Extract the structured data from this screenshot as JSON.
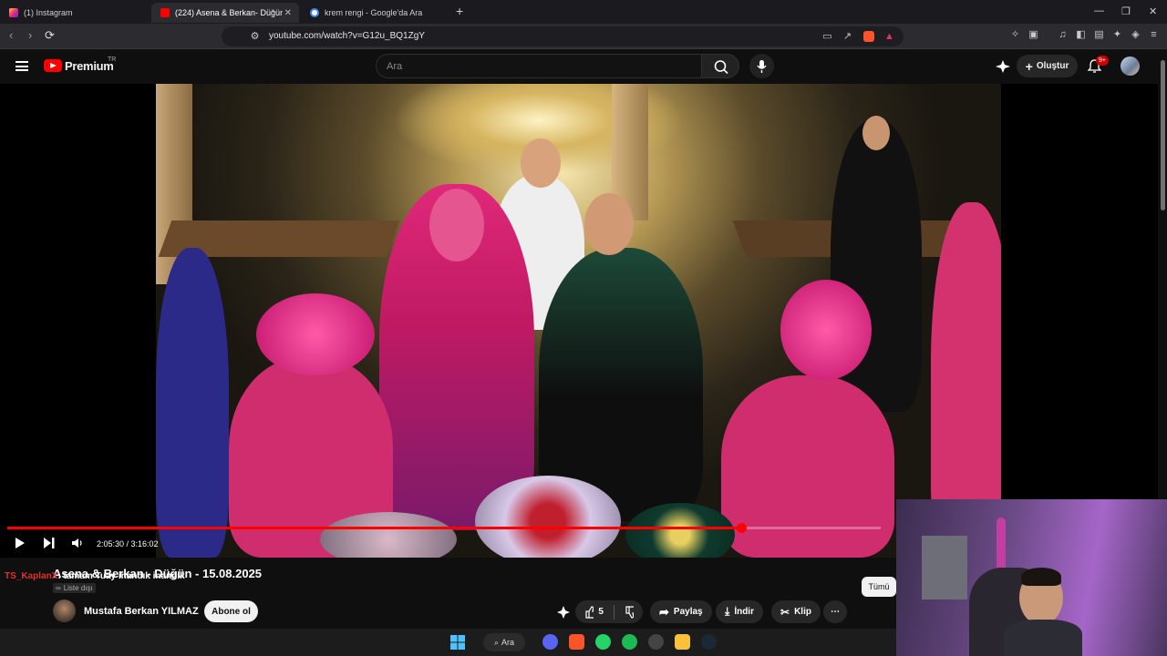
{
  "browser": {
    "tabs": [
      {
        "label": "(1) Instagram",
        "favicon": "instagram-icon"
      },
      {
        "label": "(224) Asena & Berkan- Düğün -",
        "favicon": "youtube-icon",
        "active": true
      },
      {
        "label": "krem rengi - Google'da Ara",
        "favicon": "google-icon"
      }
    ],
    "new_tab": "+",
    "url": "youtube.com/watch?v=G12u_BQ1ZgY"
  },
  "masthead": {
    "brand": "Premium",
    "region": "TR",
    "search_placeholder": "Ara",
    "create_label": "Oluştur",
    "notifications": "9+"
  },
  "video": {
    "current_time": "2:05:30 / 3:16:02",
    "progress": 0.8404
  },
  "info": {
    "title": "Asena & Berkan - Düğün - 15.08.2025",
    "unlisted": "Liste dışı",
    "channel": "Mustafa Berkan YILMAZ",
    "subscribe": "Abone ol",
    "likes": "5",
    "share": "Paylaş",
    "download": "İndir",
    "clip": "Klip",
    "all_chip": "Tümü"
  },
  "chat_overlay": {
    "user": "TS_KaplanX",
    "message": ": tamam Tuay inandık inandık"
  },
  "taskbar": {
    "search": "Ara"
  }
}
